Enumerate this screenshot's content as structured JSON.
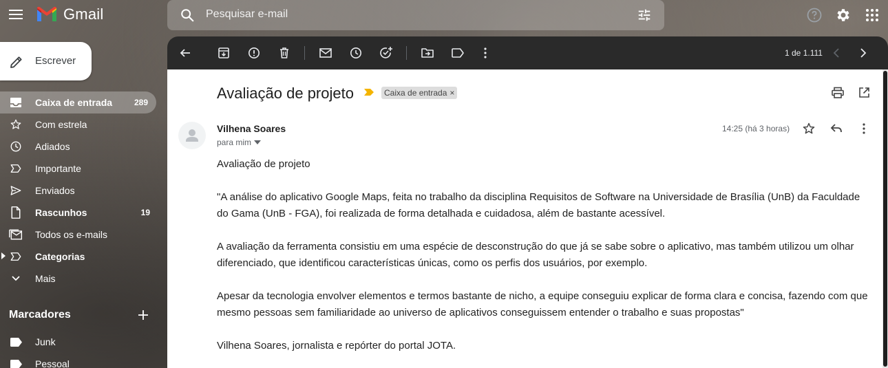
{
  "app": {
    "name": "Gmail",
    "brand_colors": {
      "red": "#EA4335",
      "blue": "#4285F4",
      "green": "#34A853",
      "yellow": "#FBBC04"
    }
  },
  "search": {
    "placeholder": "Pesquisar e-mail"
  },
  "compose": {
    "label": "Escrever"
  },
  "sidebar": {
    "items": [
      {
        "label": "Caixa de entrada",
        "count": "289",
        "icon": "inbox-icon",
        "active": true,
        "bold": true
      },
      {
        "label": "Com estrela",
        "count": "",
        "icon": "star-icon"
      },
      {
        "label": "Adiados",
        "count": "",
        "icon": "clock-icon"
      },
      {
        "label": "Importante",
        "count": "",
        "icon": "important-icon"
      },
      {
        "label": "Enviados",
        "count": "",
        "icon": "send-icon"
      },
      {
        "label": "Rascunhos",
        "count": "19",
        "icon": "draft-icon",
        "bold": true
      },
      {
        "label": "Todos os e-mails",
        "count": "",
        "icon": "all-mail-icon"
      },
      {
        "label": "Categorias",
        "count": "",
        "icon": "categories-icon",
        "bold": true
      },
      {
        "label": "Mais",
        "count": "",
        "icon": "chevron-down-icon"
      }
    ],
    "labels_header": "Marcadores",
    "labels": [
      {
        "label": "Junk",
        "icon": "label-icon"
      },
      {
        "label": "Pessoal",
        "icon": "label-icon"
      }
    ]
  },
  "toolbar": {
    "pager": "1 de 1.111"
  },
  "message": {
    "subject": "Avaliação de projeto",
    "importance_color": "#F4B400",
    "chip": {
      "label": "Caixa de entrada",
      "close": "×"
    },
    "sender": "Vilhena Soares",
    "to": "para mim",
    "time": "14:25 (há 3 horas)",
    "body": [
      "Avaliação de projeto",
      "\"A análise do aplicativo Google Maps, feita no trabalho da disciplina Requisitos de Software na Universidade de Brasília (UnB) da Faculdade do Gama (UnB - FGA), foi realizada de forma detalhada e cuidadosa, além de bastante acessível.",
      "A avaliação da ferramenta consistiu em uma espécie de desconstrução do que já se sabe sobre o aplicativo, mas também utilizou um olhar diferenciado, que identificou características únicas, como os perfis dos usuários, por exemplo.",
      "Apesar da tecnologia envolver elementos e termos bastante de nicho, a equipe conseguiu explicar de forma clara e concisa, fazendo com que mesmo pessoas sem familiaridade ao universo de aplicativos conseguissem entender o trabalho e suas propostas\"",
      "Vilhena Soares, jornalista e repórter do portal JOTA."
    ]
  }
}
